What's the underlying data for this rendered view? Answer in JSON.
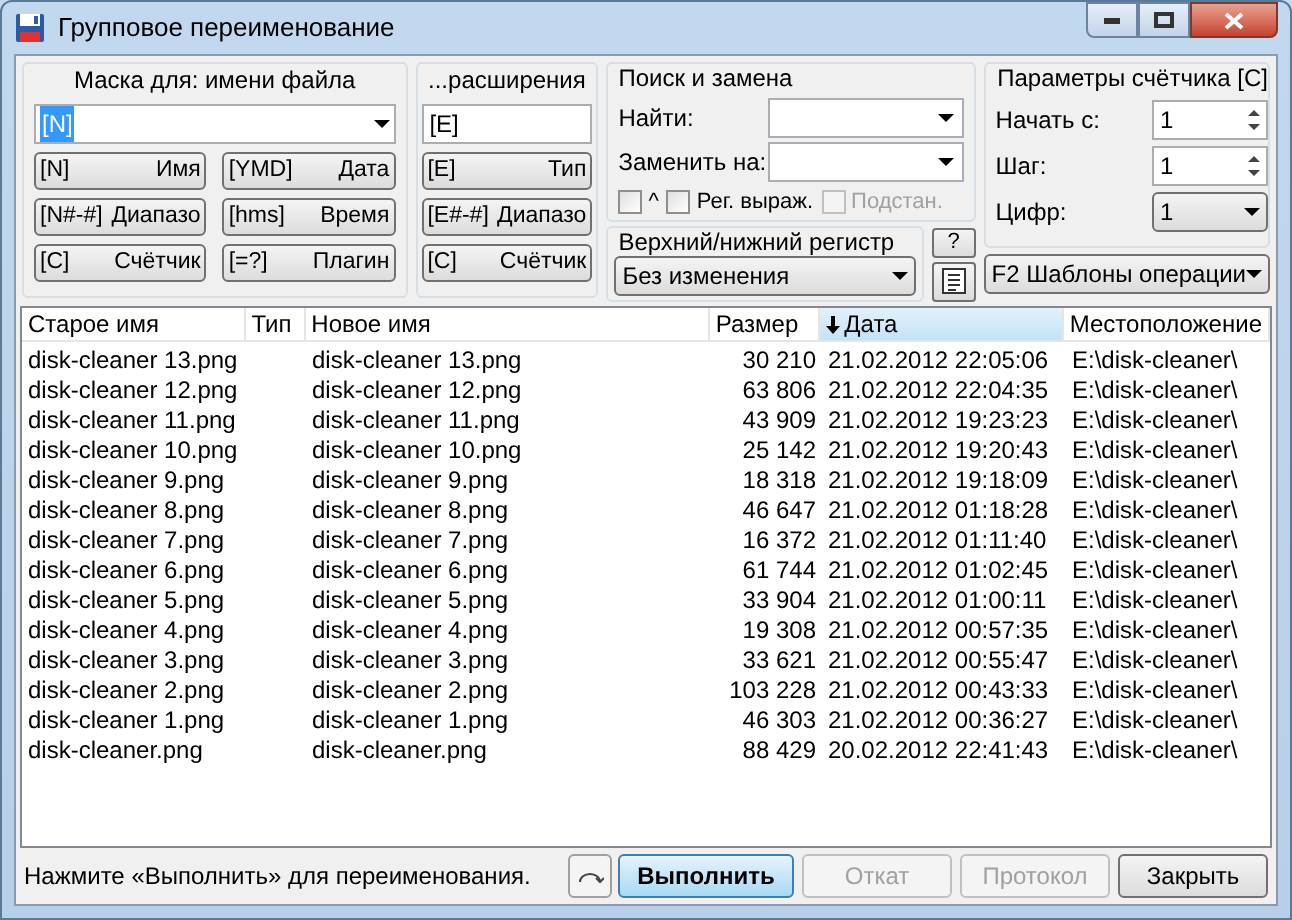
{
  "window": {
    "title": "Групповое переименование"
  },
  "mask": {
    "title": "Маска для: имени файла",
    "value": "[N]",
    "buttons": [
      {
        "code": "[N]",
        "label": "Имя"
      },
      {
        "code": "[YMD]",
        "label": "Дата"
      },
      {
        "code": "[N#-#]",
        "label": "Диапазо"
      },
      {
        "code": "[hms]",
        "label": "Время"
      },
      {
        "code": "[C]",
        "label": "Счётчик"
      },
      {
        "code": "[=?]",
        "label": "Плагин"
      }
    ]
  },
  "extension": {
    "title": "...расширения",
    "value": "[E]",
    "buttons": [
      {
        "code": "[E]",
        "label": "Тип"
      },
      {
        "code": "[E#-#]",
        "label": "Диапазо"
      },
      {
        "code": "[C]",
        "label": "Счётчик"
      }
    ]
  },
  "search_replace": {
    "title": "Поиск и замена",
    "find_label": "Найти:",
    "replace_label": "Заменить на:",
    "checkboxes": [
      {
        "label": "^",
        "checked": false,
        "disabled": false
      },
      {
        "label": "Рег. выраж.",
        "checked": false,
        "disabled": false
      },
      {
        "label": "Подстан.",
        "checked": false,
        "disabled": true
      }
    ]
  },
  "case": {
    "title": "Верхний/нижний регистр",
    "value": "Без изменения",
    "help_button": "?"
  },
  "counter": {
    "title": "Параметры счётчика [C]",
    "start_label": "Начать с:",
    "start_value": "1",
    "step_label": "Шаг:",
    "step_value": "1",
    "digits_label": "Цифр:",
    "digits_value": "1"
  },
  "templates": {
    "value": "F2 Шаблоны операции"
  },
  "table": {
    "columns": [
      {
        "label": "Старое имя",
        "sorted": false
      },
      {
        "label": "Тип",
        "sorted": false
      },
      {
        "label": "Новое имя",
        "sorted": false
      },
      {
        "label": "Размер",
        "sorted": false
      },
      {
        "label": "Дата",
        "sorted": true
      },
      {
        "label": "Местоположение",
        "sorted": false
      }
    ],
    "rows": [
      [
        "disk-cleaner 13.png",
        "",
        "disk-cleaner 13.png",
        "30 210",
        "21.02.2012 22:05:06",
        "E:\\disk-cleaner\\"
      ],
      [
        "disk-cleaner 12.png",
        "",
        "disk-cleaner 12.png",
        "63 806",
        "21.02.2012 22:04:35",
        "E:\\disk-cleaner\\"
      ],
      [
        "disk-cleaner 11.png",
        "",
        "disk-cleaner 11.png",
        "43 909",
        "21.02.2012 19:23:23",
        "E:\\disk-cleaner\\"
      ],
      [
        "disk-cleaner 10.png",
        "",
        "disk-cleaner 10.png",
        "25 142",
        "21.02.2012 19:20:43",
        "E:\\disk-cleaner\\"
      ],
      [
        "disk-cleaner 9.png",
        "",
        "disk-cleaner 9.png",
        "18 318",
        "21.02.2012 19:18:09",
        "E:\\disk-cleaner\\"
      ],
      [
        "disk-cleaner 8.png",
        "",
        "disk-cleaner 8.png",
        "46 647",
        "21.02.2012 01:18:28",
        "E:\\disk-cleaner\\"
      ],
      [
        "disk-cleaner 7.png",
        "",
        "disk-cleaner 7.png",
        "16 372",
        "21.02.2012 01:11:40",
        "E:\\disk-cleaner\\"
      ],
      [
        "disk-cleaner 6.png",
        "",
        "disk-cleaner 6.png",
        "61 744",
        "21.02.2012 01:02:45",
        "E:\\disk-cleaner\\"
      ],
      [
        "disk-cleaner 5.png",
        "",
        "disk-cleaner 5.png",
        "33 904",
        "21.02.2012 01:00:11",
        "E:\\disk-cleaner\\"
      ],
      [
        "disk-cleaner 4.png",
        "",
        "disk-cleaner 4.png",
        "19 308",
        "21.02.2012 00:57:35",
        "E:\\disk-cleaner\\"
      ],
      [
        "disk-cleaner 3.png",
        "",
        "disk-cleaner 3.png",
        "33 621",
        "21.02.2012 00:55:47",
        "E:\\disk-cleaner\\"
      ],
      [
        "disk-cleaner 2.png",
        "",
        "disk-cleaner 2.png",
        "103 228",
        "21.02.2012 00:43:33",
        "E:\\disk-cleaner\\"
      ],
      [
        "disk-cleaner 1.png",
        "",
        "disk-cleaner 1.png",
        "46 303",
        "21.02.2012 00:36:27",
        "E:\\disk-cleaner\\"
      ],
      [
        "disk-cleaner.png",
        "",
        "disk-cleaner.png",
        "88 429",
        "20.02.2012 22:41:43",
        "E:\\disk-cleaner\\"
      ]
    ]
  },
  "status": {
    "text": "Нажмите «Выполнить» для переименования.",
    "buttons": [
      {
        "label": "Выполнить",
        "kind": "default",
        "disabled": false
      },
      {
        "label": "Откат",
        "kind": "normal",
        "disabled": true
      },
      {
        "label": "Протокол",
        "kind": "normal",
        "disabled": true
      },
      {
        "label": "Закрыть",
        "kind": "normal",
        "disabled": false
      }
    ]
  }
}
